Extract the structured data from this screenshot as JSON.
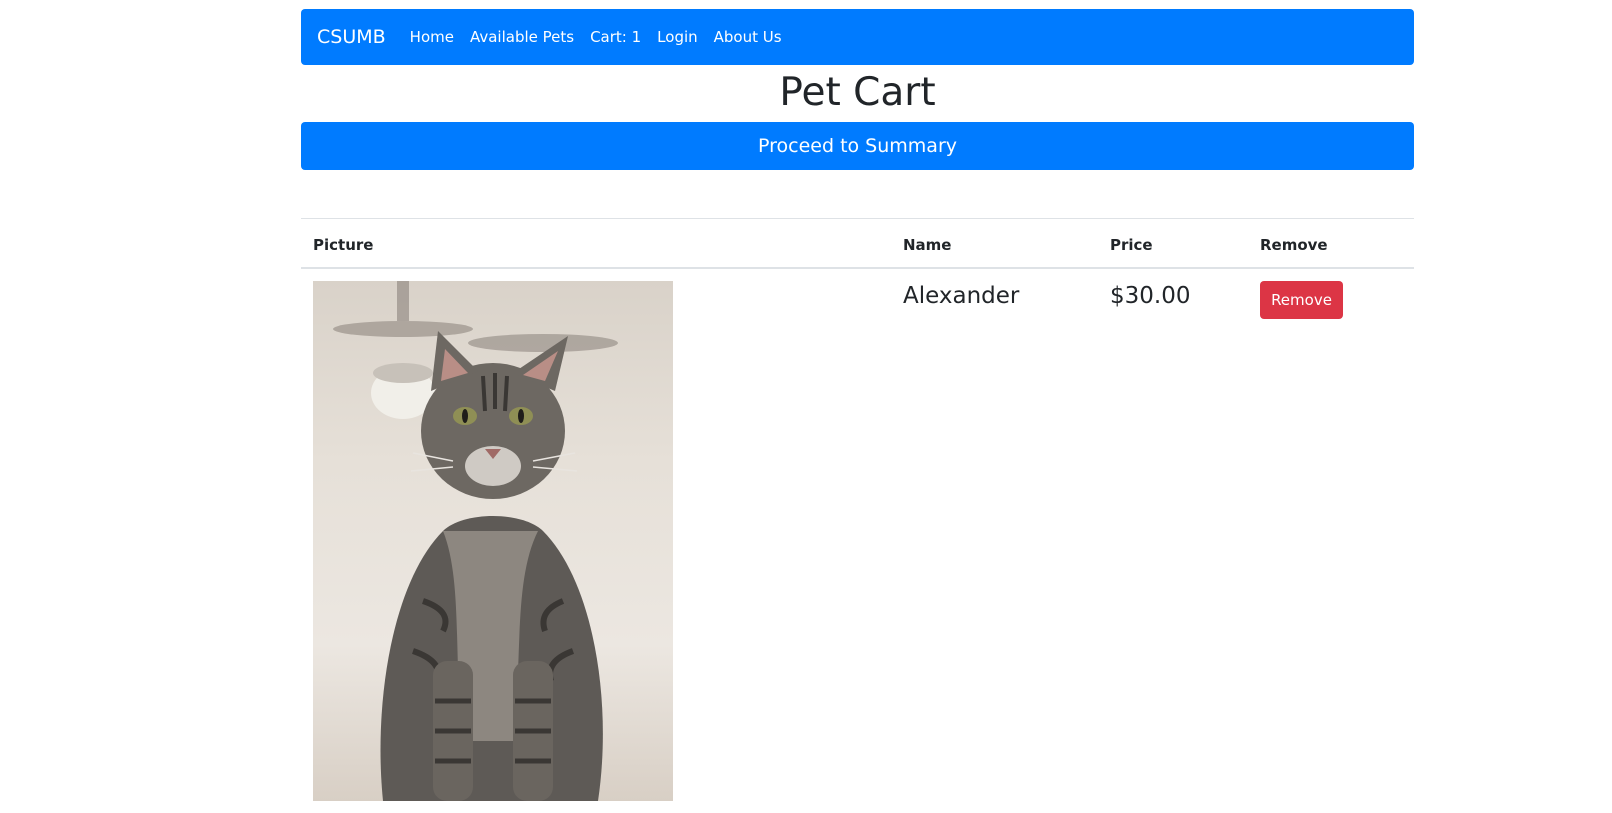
{
  "navbar": {
    "brand": "CSUMB",
    "links": [
      "Home",
      "Available Pets",
      "Cart: 1",
      "Login",
      "About Us"
    ],
    "color": "#007bff"
  },
  "page": {
    "title": "Pet Cart",
    "summary_button": "Proceed to Summary"
  },
  "table": {
    "headers": [
      "Picture",
      "Name",
      "Price",
      "Remove"
    ],
    "rows": [
      {
        "name": "Alexander",
        "price": "$30.00",
        "remove_label": "Remove",
        "picture": "gray-tabby-cat-photo"
      }
    ]
  },
  "colors": {
    "primary": "#007bff",
    "danger": "#dc3545"
  }
}
